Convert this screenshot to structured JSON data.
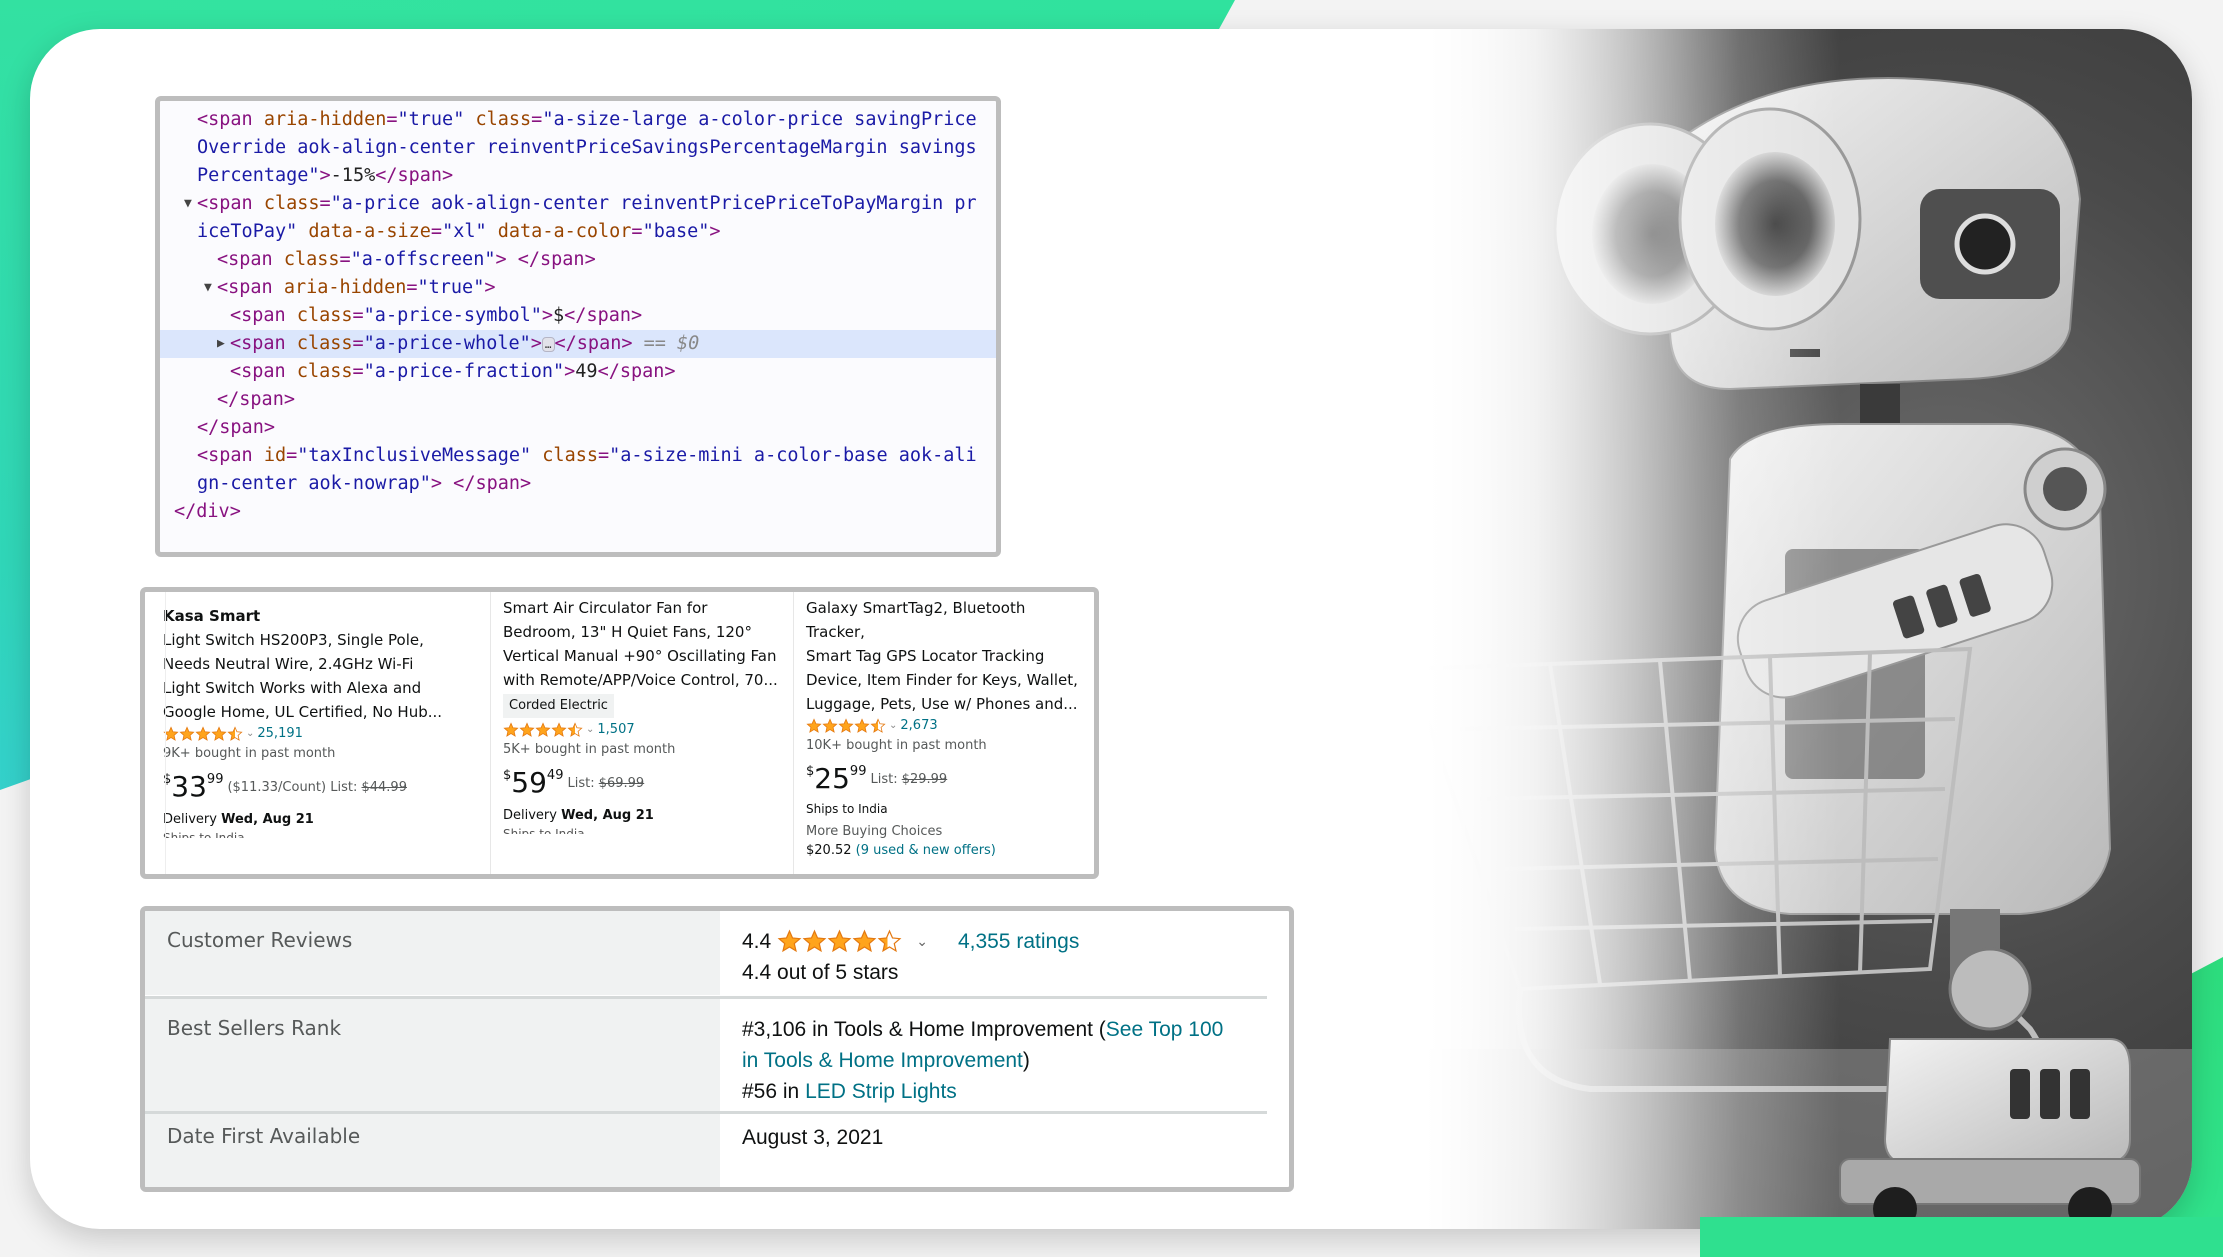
{
  "colors": {
    "accent_green": "#33e3a0",
    "star_orange": "#ffa41c",
    "link_teal": "#007185",
    "code_tag": "#881280",
    "code_attr": "#994500",
    "code_value": "#1a1aa6",
    "code_highlight": "#dbe6fc"
  },
  "code_panel": {
    "lines": [
      {
        "indent": 1,
        "tokens": [
          [
            "tg",
            "<span "
          ],
          [
            "an",
            "aria-hidden"
          ],
          [
            "tg",
            "="
          ],
          [
            "av",
            "\"true\""
          ],
          [
            "tg",
            " "
          ],
          [
            "an",
            "class"
          ],
          [
            "tg",
            "="
          ],
          [
            "av",
            "\"a-size-large a-color-price savingPrice"
          ]
        ]
      },
      {
        "indent": 1,
        "tokens": [
          [
            "av",
            "Override aok-align-center reinventPriceSavingsPercentageMargin savings"
          ]
        ]
      },
      {
        "indent": 1,
        "tokens": [
          [
            "av",
            "Percentage\""
          ],
          [
            "tg",
            ">"
          ],
          [
            "tx",
            "-15%"
          ],
          [
            "tg",
            "</span>"
          ]
        ]
      },
      {
        "indent": 1,
        "toggle": "expanded",
        "tokens": [
          [
            "tg",
            "<span "
          ],
          [
            "an",
            "class"
          ],
          [
            "tg",
            "="
          ],
          [
            "av",
            "\"a-price aok-align-center reinventPricePriceToPayMargin pr"
          ]
        ]
      },
      {
        "indent": 1,
        "tokens": [
          [
            "av",
            "iceToPay\""
          ],
          [
            "tg",
            " "
          ],
          [
            "an",
            "data-a-size"
          ],
          [
            "tg",
            "="
          ],
          [
            "av",
            "\"xl\""
          ],
          [
            "tg",
            " "
          ],
          [
            "an",
            "data-a-color"
          ],
          [
            "tg",
            "="
          ],
          [
            "av",
            "\"base\""
          ],
          [
            "tg",
            ">"
          ]
        ]
      },
      {
        "indent": 2,
        "tokens": [
          [
            "tg",
            "<span "
          ],
          [
            "an",
            "class"
          ],
          [
            "tg",
            "="
          ],
          [
            "av",
            "\"a-offscreen\""
          ],
          [
            "tg",
            "> </span>"
          ]
        ]
      },
      {
        "indent": 2,
        "toggle": "expanded",
        "tokens": [
          [
            "tg",
            "<span "
          ],
          [
            "an",
            "aria-hidden"
          ],
          [
            "tg",
            "="
          ],
          [
            "av",
            "\"true\""
          ],
          [
            "tg",
            ">"
          ]
        ]
      },
      {
        "indent": 3,
        "tokens": [
          [
            "tg",
            "<span "
          ],
          [
            "an",
            "class"
          ],
          [
            "tg",
            "="
          ],
          [
            "av",
            "\"a-price-symbol\""
          ],
          [
            "tg",
            ">"
          ],
          [
            "tx",
            "$"
          ],
          [
            "tg",
            "</span>"
          ]
        ]
      },
      {
        "indent": 3,
        "toggle": "collapsed",
        "highlighted": true,
        "tokens": [
          [
            "tg",
            "<span "
          ],
          [
            "an",
            "class"
          ],
          [
            "tg",
            "="
          ],
          [
            "av",
            "\"a-price-whole\""
          ],
          [
            "tg",
            ">"
          ],
          [
            "ellipsis",
            "…"
          ],
          [
            "tg",
            "</span>"
          ],
          [
            "eq",
            " == "
          ],
          [
            "sv",
            "$0"
          ]
        ]
      },
      {
        "indent": 3,
        "tokens": [
          [
            "tg",
            "<span "
          ],
          [
            "an",
            "class"
          ],
          [
            "tg",
            "="
          ],
          [
            "av",
            "\"a-price-fraction\""
          ],
          [
            "tg",
            ">"
          ],
          [
            "tx",
            "49"
          ],
          [
            "tg",
            "</span>"
          ]
        ]
      },
      {
        "indent": 2,
        "tokens": [
          [
            "tg",
            "</span>"
          ]
        ]
      },
      {
        "indent": 1,
        "tokens": [
          [
            "tg",
            "</span>"
          ]
        ]
      },
      {
        "indent": 1,
        "tokens": [
          [
            "tg",
            "<span "
          ],
          [
            "an",
            "id"
          ],
          [
            "tg",
            "="
          ],
          [
            "av",
            "\"taxInclusiveMessage\""
          ],
          [
            "tg",
            " "
          ],
          [
            "an",
            "class"
          ],
          [
            "tg",
            "="
          ],
          [
            "av",
            "\"a-size-mini a-color-base aok-ali"
          ]
        ]
      },
      {
        "indent": 1,
        "tokens": [
          [
            "av",
            "gn-center aok-nowrap\""
          ],
          [
            "tg",
            "> </span>"
          ]
        ]
      },
      {
        "indent": 0,
        "tokens": [
          [
            "tg",
            "</div>"
          ]
        ]
      }
    ]
  },
  "products": [
    {
      "brand": "Kasa Smart",
      "title_lines": [
        "Light Switch HS200P3, Single Pole,",
        "Needs Neutral Wire, 2.4GHz Wi-Fi",
        "Light Switch Works with Alexa and",
        "Google Home, UL Certified, No Hub..."
      ],
      "rating": 4.5,
      "rating_count": "25,191",
      "bought": "9K+ bought in past month",
      "price_currency": "$",
      "price_whole": "33",
      "price_fraction": "99",
      "unit_price": "($11.33/Count)",
      "list_label": "List:",
      "list_price": "$44.99",
      "delivery_label": "Delivery",
      "delivery_date": "Wed, Aug 21",
      "cut_text": "Ships to India"
    },
    {
      "title_lines": [
        "Smart Air Circulator Fan for",
        "Bedroom, 13\" H Quiet Fans, 120°",
        "Vertical Manual +90° Oscillating Fan",
        "with Remote/APP/Voice Control, 70..."
      ],
      "badge": "Corded Electric",
      "rating": 4.5,
      "rating_count": "1,507",
      "bought": "5K+ bought in past month",
      "price_currency": "$",
      "price_whole": "59",
      "price_fraction": "49",
      "list_label": "List:",
      "list_price": "$69.99",
      "delivery_label": "Delivery",
      "delivery_date": "Wed, Aug 21",
      "cut_text": "Ships to India"
    },
    {
      "title_lines": [
        "Galaxy SmartTag2, Bluetooth Tracker,",
        "Smart Tag GPS Locator Tracking",
        "Device, Item Finder for Keys, Wallet,",
        "Luggage, Pets, Use w/ Phones and..."
      ],
      "rating": 4.5,
      "rating_count": "2,673",
      "bought": "10K+ bought in past month",
      "price_currency": "$",
      "price_whole": "25",
      "price_fraction": "99",
      "list_label": "List:",
      "list_price": "$29.99",
      "ships": "Ships to India",
      "more_choices": "More Buying Choices",
      "offer_price": "$20.52",
      "offer_link": "(9 used & new offers)"
    }
  ],
  "details": {
    "customer_reviews": {
      "label": "Customer Reviews",
      "score": "4.4",
      "rating": 4.4,
      "ratings_link": "4,355 ratings",
      "out_of": "4.4 out of 5 stars"
    },
    "best_sellers_rank": {
      "label": "Best Sellers Rank",
      "rank1_text": "#3,106 in Tools & Home Improvement (",
      "rank1_link": "See Top 100",
      "rank1_link_cont": "in Tools & Home Improvement",
      "rank1_close": ")",
      "rank2_prefix": "#56 in ",
      "rank2_link": "LED Strip Lights"
    },
    "date_first_available": {
      "label": "Date First Available",
      "value": "August 3, 2021"
    }
  },
  "illustration": {
    "subject": "robot-pushing-shopping-cart"
  }
}
